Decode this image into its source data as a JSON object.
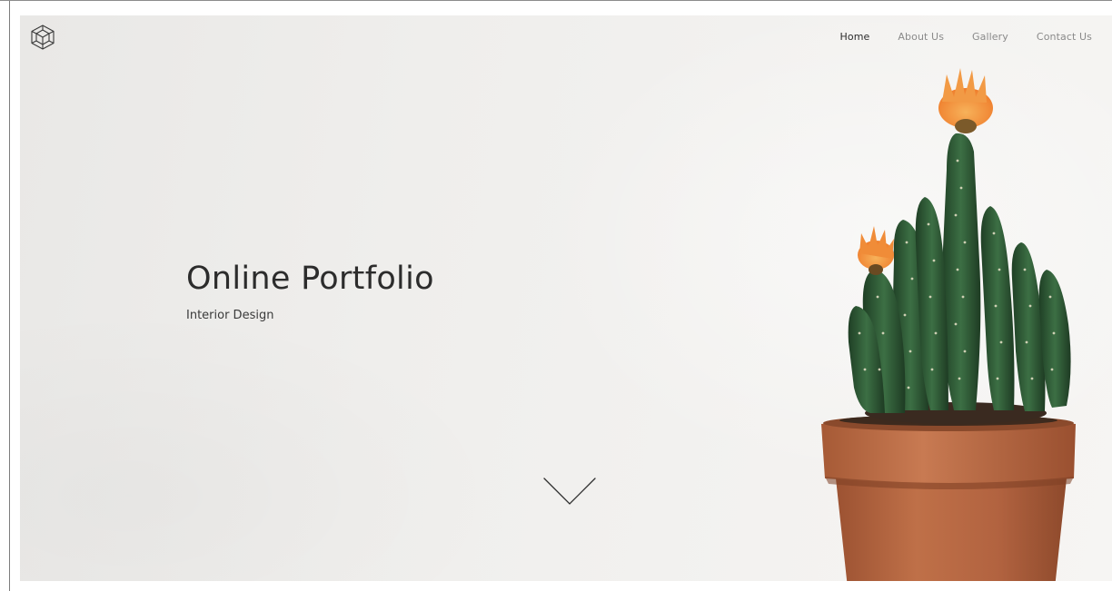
{
  "brand": {
    "logo_icon": "isometric-cube-logo-icon"
  },
  "nav": {
    "items": [
      {
        "label": "Home",
        "active": true
      },
      {
        "label": "About Us",
        "active": false
      },
      {
        "label": "Gallery",
        "active": false
      },
      {
        "label": "Contact Us",
        "active": false
      }
    ]
  },
  "hero": {
    "title": "Online Portfolio",
    "subtitle": "Interior Design",
    "scroll_icon": "chevron-down-icon",
    "image": "potted-cactus-with-orange-flowers"
  },
  "colors": {
    "background": "#efeeec",
    "text_dark": "#2c2c2c",
    "nav_muted": "#8a8a8a",
    "pot": "#b5673f",
    "cactus": "#2f5a36",
    "flower": "#f2913a"
  }
}
